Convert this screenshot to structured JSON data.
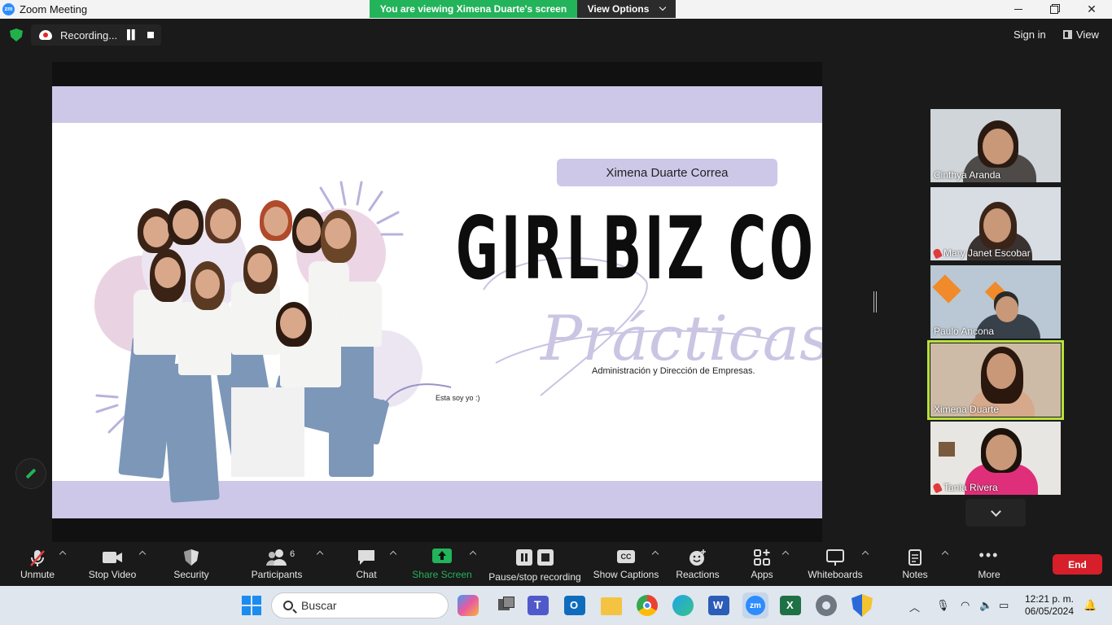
{
  "window": {
    "title": "Zoom Meeting",
    "viewing_banner": "You are viewing Ximena Duarte's screen",
    "view_options_label": "View Options"
  },
  "topbar": {
    "recording_label": "Recording...",
    "signin_label": "Sign in",
    "view_label": "View"
  },
  "slide": {
    "name_pill": "Ximena Duarte Correa",
    "brand": "GIRLBIZ CO",
    "script_word": "Prácticas",
    "subtitle": "Administración y Dirección de Empresas.",
    "caption": "Esta soy yo :)"
  },
  "participants": [
    {
      "name": "Cinthya Aranda",
      "muted": false
    },
    {
      "name": "Mary Janet Escobar",
      "muted": true
    },
    {
      "name": "Paulo Ancona",
      "muted": false
    },
    {
      "name": "Ximena Duarte",
      "muted": false,
      "active": true
    },
    {
      "name": "Tania Rivera",
      "muted": true
    }
  ],
  "toolbar": {
    "unmute": "Unmute",
    "stop_video": "Stop Video",
    "security": "Security",
    "participants": "Participants",
    "participants_count": "6",
    "chat": "Chat",
    "share_screen": "Share Screen",
    "pause_recording": "Pause/stop recording",
    "show_captions": "Show Captions",
    "reactions": "Reactions",
    "apps": "Apps",
    "whiteboards": "Whiteboards",
    "notes": "Notes",
    "more": "More",
    "end": "End",
    "cc_badge": "CC"
  },
  "taskbar": {
    "search_placeholder": "Buscar",
    "time": "12:21 p. m.",
    "date": "06/05/2024"
  },
  "colors": {
    "zoom_green": "#23b35a",
    "slide_lavender": "#cdc8e8",
    "end_red": "#d61f2b",
    "active_speaker": "#b8e13b"
  }
}
